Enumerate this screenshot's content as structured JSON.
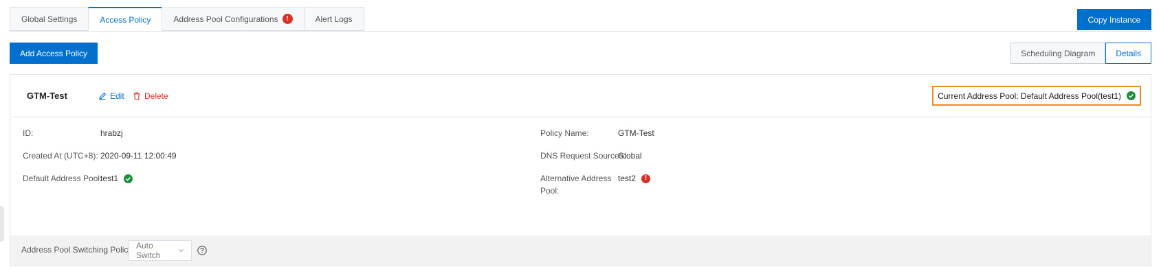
{
  "tabs": [
    {
      "label": "Global Settings",
      "active": false
    },
    {
      "label": "Access Policy",
      "active": true
    },
    {
      "label": "Address Pool Configurations",
      "active": false,
      "badge": "!"
    },
    {
      "label": "Alert Logs",
      "active": false
    }
  ],
  "toolbar": {
    "copy_instance": "Copy Instance",
    "add_access_policy": "Add Access Policy",
    "views": [
      "Scheduling Diagram",
      "Details"
    ],
    "active_view": "Details"
  },
  "policy": {
    "name": "GTM-Test",
    "edit_label": "Edit",
    "delete_label": "Delete",
    "current_pool": "Current Address Pool: Default Address Pool(test1)",
    "fields": {
      "id": {
        "label": "ID:",
        "value": "hrabzj"
      },
      "created_at": {
        "label": "Created At (UTC+8):",
        "value": "2020-09-11 12:00:49"
      },
      "default_pool": {
        "label": "Default Address Pool:",
        "value": "test1",
        "status": "ok"
      },
      "policy_name": {
        "label": "Policy Name:",
        "value": "GTM-Test"
      },
      "dns_sources": {
        "label": "DNS Request Sources:",
        "value": "Global"
      },
      "alt_pool": {
        "label_line1": "Alternative Address",
        "label_line2": "Pool:",
        "value": "test2",
        "status": "warning"
      }
    },
    "switching": {
      "label": "Address Pool Switching Policy:",
      "value": "Auto Switch"
    }
  },
  "colors": {
    "primary": "#0070cc",
    "danger": "#d93026",
    "success": "#1e8e3e",
    "highlight": "#f08a24"
  }
}
